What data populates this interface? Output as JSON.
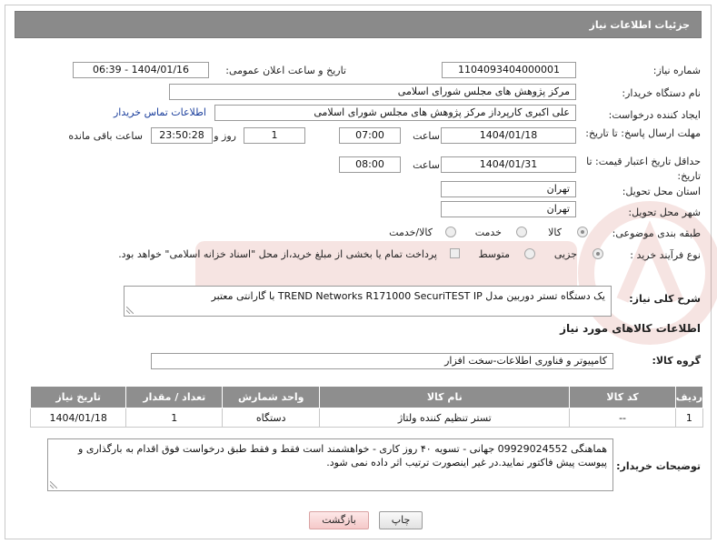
{
  "header": {
    "title": "جزئیات اطلاعات نیاز"
  },
  "form": {
    "need_number_label": "شماره نیاز:",
    "need_number": "1104093404000001",
    "announce_label": "تاریخ و ساعت اعلان عمومی:",
    "announce_value": "1404/01/16 - 06:39",
    "buyer_label": "نام دستگاه خریدار:",
    "buyer_value": "مرکز پژوهش های مجلس شورای اسلامی",
    "creator_label": "ایجاد کننده درخواست:",
    "creator_value": "علی اکبری کارپرداز مرکز پژوهش های مجلس شورای اسلامی",
    "contact_link": "اطلاعات تماس خریدار",
    "reply_deadline_label": "مهلت ارسال پاسخ: تا تاریخ:",
    "reply_date": "1404/01/18",
    "time_label": "ساعت",
    "reply_time": "07:00",
    "days_count": "1",
    "day_and_label": "روز و",
    "remaining_time": "23:50:28",
    "remaining_label": "ساعت باقی مانده",
    "price_validity_label": "حداقل تاریخ اعتبار قیمت: تا تاریخ:",
    "price_date": "1404/01/31",
    "price_time": "08:00",
    "province_label": "استان محل تحویل:",
    "province_value": "تهران",
    "city_label": "شهر محل تحویل:",
    "city_value": "تهران",
    "category_label": "طبقه بندی موضوعی:",
    "category_options": [
      "کالا",
      "خدمت",
      "کالا/خدمت"
    ],
    "process_label": "نوع فرآیند خرید :",
    "process_options": [
      "جزیی",
      "متوسط"
    ],
    "payment_note": "پرداخت تمام یا بخشی از مبلغ خرید،از محل \"اسناد خزانه اسلامی\" خواهد بود.",
    "desc_label": "شرح کلی نیاز:",
    "desc_value": "یک دستگاه تستر دوربین مدل TREND Networks R171000  SecuriTEST IP با گارانتی معتبر",
    "goods_section_title": "اطلاعات کالاهای مورد نیاز",
    "goods_group_label": "گروه کالا:",
    "goods_group_value": "کامپیوتر و فناوری اطلاعات-سخت افزار",
    "buyer_notes_label": "توضیحات خریدار:",
    "buyer_notes_value": "هماهنگی 09929024552  جهانی  - تسویه ۴۰ روز کاری - خواهشمند است فقط و فقط طبق درخواست فوق اقدام به بارگذاری و پیوست پیش فاکتور نمایید.در غیر اینصورت ترتیب اثر داده نمی شود."
  },
  "table": {
    "headers": [
      "ردیف",
      "کد کالا",
      "نام کالا",
      "واحد شمارش",
      "تعداد / مقدار",
      "تاریخ نیاز"
    ],
    "rows": [
      [
        "1",
        "--",
        "تستر تنظیم کننده ولتاژ",
        "دستگاه",
        "1",
        "1404/01/18"
      ]
    ]
  },
  "buttons": {
    "print": "چاپ",
    "back": "بازگشت"
  },
  "colors": {
    "header_bg": "#8a8a8a",
    "link": "#1a3e9c",
    "back_button": "#f5c9c9"
  }
}
